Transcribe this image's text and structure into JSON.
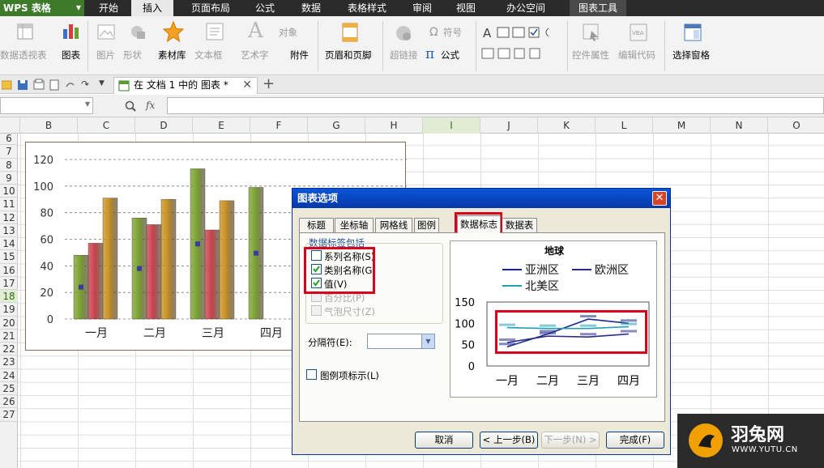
{
  "app": {
    "title": "WPS 表格"
  },
  "menu": [
    "开始",
    "插入",
    "页面布局",
    "公式",
    "数据",
    "表格样式",
    "审阅",
    "视图",
    "办公空间"
  ],
  "menu_active": "插入",
  "menu_tool": "图表工具",
  "ribbon": {
    "pivot": "数据透视表",
    "chart": "图表",
    "picture": "图片",
    "shape": "形状",
    "material": "素材库",
    "textbox": "文本框",
    "wordart": "艺术字",
    "object": "对象",
    "attachment": "附件",
    "header_footer": "页眉和页脚",
    "hyperlink": "超链接",
    "symbol": "符号",
    "formula": "公式",
    "control_props": "控件属性",
    "edit_code": "编辑代码",
    "selection_pane": "选择窗格"
  },
  "doc_tab": "在 文档 1 中的 图表 *",
  "formula_bar": {
    "fx": "fx"
  },
  "columns": [
    "B",
    "C",
    "D",
    "E",
    "F",
    "G",
    "H",
    "I",
    "J",
    "K",
    "L",
    "M",
    "N",
    "O"
  ],
  "selected_column": "I",
  "rows": [
    "6",
    "7",
    "8",
    "9",
    "10",
    "11",
    "12",
    "13",
    "14",
    "15",
    "16",
    "17",
    "18",
    "19",
    "20",
    "21",
    "22",
    "23",
    "24",
    "25",
    "26",
    "27"
  ],
  "selected_row": "18",
  "chart_data": {
    "type": "bar",
    "categories": [
      "一月",
      "二月",
      "三月",
      "四月"
    ],
    "series": [
      {
        "values": [
          48,
          76,
          113,
          99
        ],
        "color": "#7aa230"
      },
      {
        "values": [
          57,
          71,
          67,
          null
        ],
        "color": "#c8404c"
      },
      {
        "values": [
          91,
          90,
          89,
          null
        ],
        "color": "#c89020"
      }
    ],
    "ylim": [
      0,
      120
    ],
    "yticks": [
      "0",
      "20",
      "40",
      "60",
      "80",
      "100",
      "120"
    ],
    "grid": true
  },
  "dialog": {
    "title": "图表选项",
    "tabs": [
      "标题",
      "坐标轴",
      "网格线",
      "图例",
      "数据标志",
      "数据表"
    ],
    "active_tab": "数据标志",
    "group_label": "数据标签包括",
    "checkboxes": [
      {
        "label": "系列名称(S)",
        "checked": false,
        "enabled": true
      },
      {
        "label": "类别名称(G)",
        "checked": true,
        "enabled": true
      },
      {
        "label": "值(V)",
        "checked": true,
        "enabled": true
      },
      {
        "label": "百分比(P)",
        "checked": false,
        "enabled": false
      },
      {
        "label": "气泡尺寸(Z)",
        "checked": false,
        "enabled": false
      }
    ],
    "separator_label": "分隔符(E):",
    "legend_key_label": "图例项标示(L)",
    "buttons": {
      "cancel": "取消",
      "back": "< 上一步(B)",
      "next": "下一步(N) >",
      "finish": "完成(F)"
    },
    "preview": {
      "title": "地球",
      "legend": [
        "亚洲区",
        "欧洲区",
        "北美区"
      ],
      "legend_colors": [
        "#1a2a8a",
        "#2a2a8a",
        "#20a0b0"
      ],
      "yticks": [
        "0",
        "50",
        "100",
        "150"
      ],
      "categories": [
        "一月",
        "二月",
        "三月",
        "四月"
      ],
      "chart_data": {
        "type": "line",
        "categories": [
          "一月",
          "二月",
          "三月",
          "四月"
        ],
        "series": [
          {
            "name": "亚洲区",
            "values": [
              45,
              75,
              110,
              100
            ]
          },
          {
            "name": "欧洲区",
            "values": [
              55,
              70,
              68,
              75
            ]
          },
          {
            "name": "北美区",
            "values": [
              90,
              88,
              88,
              92
            ]
          }
        ],
        "ylim": [
          0,
          150
        ]
      }
    }
  },
  "watermark": {
    "brand": "羽兔网",
    "url": "WWW.YUTU.CN"
  }
}
